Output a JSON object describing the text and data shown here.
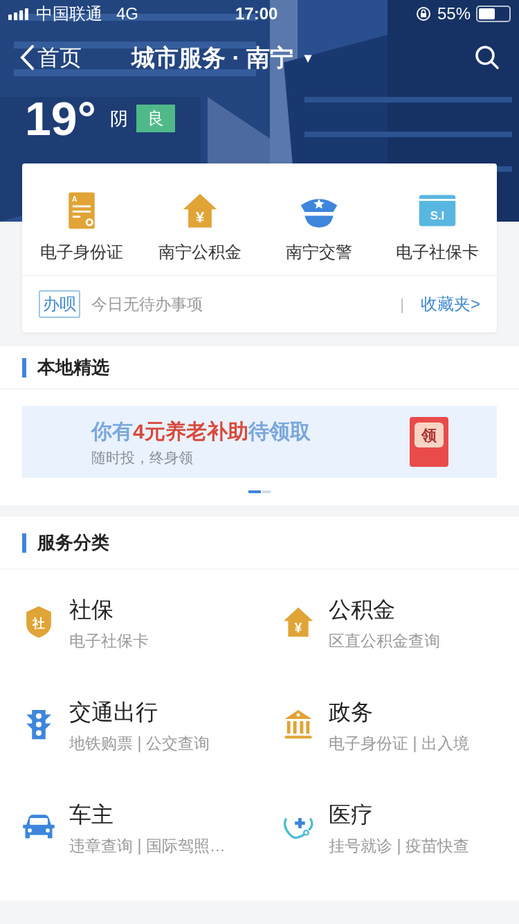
{
  "status_bar": {
    "carrier": "中国联通",
    "network": "4G",
    "time": "17:00",
    "battery": "55%"
  },
  "nav": {
    "back": "首页",
    "title": "城市服务 · 南宁",
    "caret": "▾"
  },
  "weather": {
    "temperature": "19°",
    "condition": "阴",
    "air_quality": "良"
  },
  "quick_services": [
    {
      "label": "电子身份证",
      "kind": "id-card",
      "icon_text": "A"
    },
    {
      "label": "南宁公积金",
      "kind": "house-yen",
      "icon_text": "¥"
    },
    {
      "label": "南宁交警",
      "kind": "police-cap"
    },
    {
      "label": "电子社保卡",
      "kind": "card",
      "icon_text": "S.I"
    }
  ],
  "todo": {
    "tag": "办呗",
    "text": "今日无待办事项",
    "separator": "|",
    "link": "收藏夹>"
  },
  "local_picks": {
    "title": "本地精选",
    "banner": {
      "title": "你有**4元养老补助**待领取",
      "subtitle": "随时投，终身领",
      "badge": "领"
    },
    "pages": [
      {
        "selected": true
      },
      {
        "selected": false
      }
    ]
  },
  "categories": {
    "title": "服务分类",
    "items": [
      {
        "name": "社保",
        "desc": "电子社保卡",
        "kind": "shield",
        "icon_text": "社"
      },
      {
        "name": "公积金",
        "desc": "区直公积金查询",
        "kind": "house-yen",
        "icon_text": "¥"
      },
      {
        "name": "交通出行",
        "desc": "地铁购票 | 公交查询",
        "kind": "traffic-light"
      },
      {
        "name": "政务",
        "desc": "电子身份证 | 出入境",
        "kind": "bank"
      },
      {
        "name": "车主",
        "desc": "违章查询 | 国际驾照…",
        "kind": "car"
      },
      {
        "name": "医疗",
        "desc": "挂号就诊 | 疫苗快查",
        "kind": "medical"
      }
    ]
  }
}
